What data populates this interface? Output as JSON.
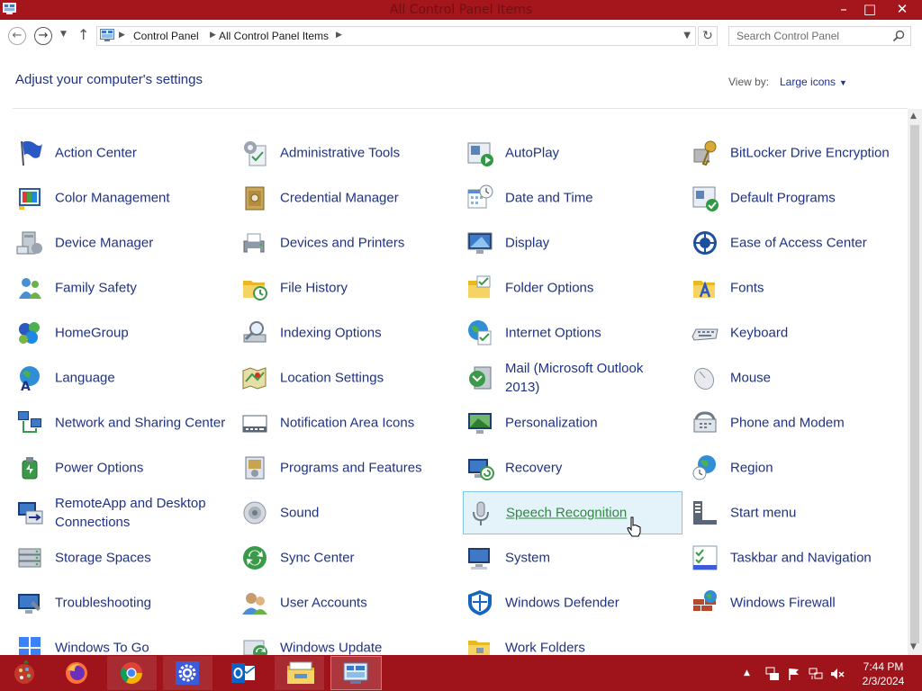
{
  "window": {
    "title": "All Control Panel Items",
    "minimize": "–",
    "maximize": "□",
    "close": "✕"
  },
  "address": {
    "breadcrumbs": [
      "Control Panel",
      "All Control Panel Items"
    ],
    "search_placeholder": "Search Control Panel"
  },
  "header": {
    "title": "Adjust your computer's settings",
    "view_by_label": "View by:",
    "view_by_value": "Large icons"
  },
  "items": [
    {
      "label": "Action Center",
      "icon": "action-center-flag-icon"
    },
    {
      "label": "Administrative Tools",
      "icon": "administrative-tools-icon"
    },
    {
      "label": "AutoPlay",
      "icon": "autoplay-icon"
    },
    {
      "label": "BitLocker Drive Encryption",
      "icon": "bitlocker-key-icon"
    },
    {
      "label": "Color Management",
      "icon": "color-management-icon"
    },
    {
      "label": "Credential Manager",
      "icon": "credential-manager-vault-icon"
    },
    {
      "label": "Date and Time",
      "icon": "date-time-calendar-icon"
    },
    {
      "label": "Default Programs",
      "icon": "default-programs-icon"
    },
    {
      "label": "Device Manager",
      "icon": "device-manager-icon"
    },
    {
      "label": "Devices and Printers",
      "icon": "devices-printers-icon"
    },
    {
      "label": "Display",
      "icon": "display-monitor-icon"
    },
    {
      "label": "Ease of Access Center",
      "icon": "ease-of-access-icon"
    },
    {
      "label": "Family Safety",
      "icon": "family-safety-icon"
    },
    {
      "label": "File History",
      "icon": "file-history-folder-icon"
    },
    {
      "label": "Folder Options",
      "icon": "folder-options-icon"
    },
    {
      "label": "Fonts",
      "icon": "fonts-folder-icon"
    },
    {
      "label": "HomeGroup",
      "icon": "homegroup-icon"
    },
    {
      "label": "Indexing Options",
      "icon": "indexing-magnifier-icon"
    },
    {
      "label": "Internet Options",
      "icon": "internet-options-globe-icon"
    },
    {
      "label": "Keyboard",
      "icon": "keyboard-icon"
    },
    {
      "label": "Language",
      "icon": "language-globe-icon"
    },
    {
      "label": "Location Settings",
      "icon": "location-map-icon"
    },
    {
      "label": "Mail (Microsoft Outlook 2013)",
      "icon": "mail-icon"
    },
    {
      "label": "Mouse",
      "icon": "mouse-icon"
    },
    {
      "label": "Network and Sharing Center",
      "icon": "network-sharing-icon"
    },
    {
      "label": "Notification Area Icons",
      "icon": "notification-area-icon"
    },
    {
      "label": "Personalization",
      "icon": "personalization-icon"
    },
    {
      "label": "Phone and Modem",
      "icon": "phone-modem-icon"
    },
    {
      "label": "Power Options",
      "icon": "power-options-icon"
    },
    {
      "label": "Programs and Features",
      "icon": "programs-features-icon"
    },
    {
      "label": "Recovery",
      "icon": "recovery-icon"
    },
    {
      "label": "Region",
      "icon": "region-globe-icon"
    },
    {
      "label": "RemoteApp and Desktop Connections",
      "icon": "remoteapp-icon"
    },
    {
      "label": "Sound",
      "icon": "sound-speaker-icon"
    },
    {
      "label": "Speech Recognition",
      "icon": "microphone-icon"
    },
    {
      "label": "Start menu",
      "icon": "start-menu-icon"
    },
    {
      "label": "Storage Spaces",
      "icon": "storage-spaces-icon"
    },
    {
      "label": "Sync Center",
      "icon": "sync-center-icon"
    },
    {
      "label": "System",
      "icon": "system-monitor-icon"
    },
    {
      "label": "Taskbar and Navigation",
      "icon": "taskbar-navigation-icon"
    },
    {
      "label": "Troubleshooting",
      "icon": "troubleshooting-icon"
    },
    {
      "label": "User Accounts",
      "icon": "user-accounts-icon"
    },
    {
      "label": "Windows Defender",
      "icon": "windows-defender-shield-icon"
    },
    {
      "label": "Windows Firewall",
      "icon": "windows-firewall-icon"
    },
    {
      "label": "Windows To Go",
      "icon": "windows-to-go-icon"
    },
    {
      "label": "Windows Update",
      "icon": "windows-update-icon"
    },
    {
      "label": "Work Folders",
      "icon": "work-folders-icon"
    }
  ],
  "hovered_item": "Speech Recognition",
  "taskbar": {
    "apps": [
      "start-orb-icon",
      "firefox-icon",
      "chrome-icon",
      "settings-gear-icon",
      "outlook-icon",
      "file-explorer-icon",
      "control-panel-icon"
    ],
    "clock_time": "7:44 PM",
    "clock_date": "2/3/2024"
  },
  "colors": {
    "titlebar": "#a4161b",
    "taskbar": "#9e141a",
    "link": "#1e3287",
    "hover_link": "#2f8a3e",
    "hover_bg": "#e4f2fa",
    "hover_border": "#86c6e7"
  }
}
